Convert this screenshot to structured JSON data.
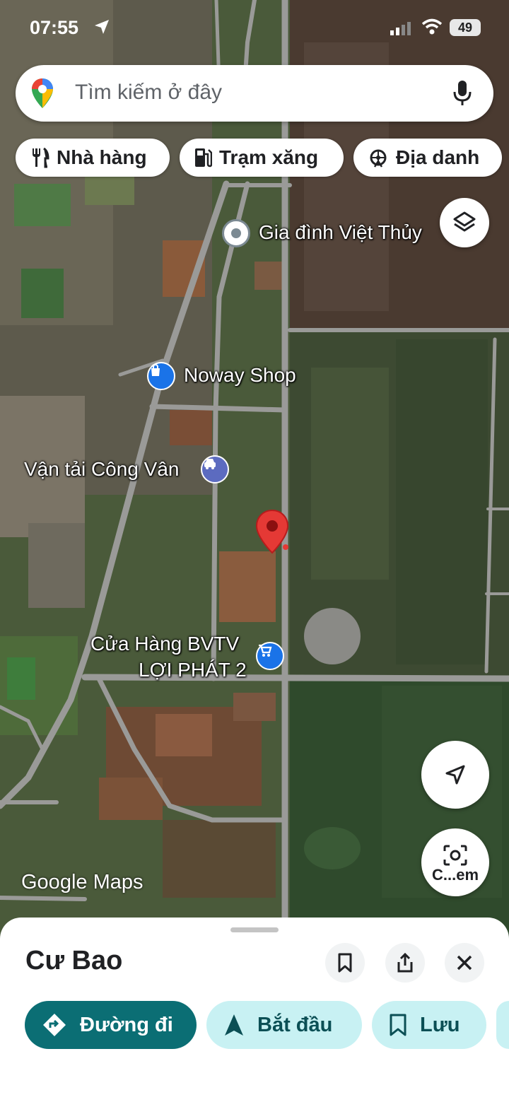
{
  "status_bar": {
    "time": "07:55",
    "battery": "49"
  },
  "search": {
    "placeholder": "Tìm kiếm ở đây"
  },
  "chips": [
    {
      "label": "Nhà hàng",
      "icon": "restaurant-icon"
    },
    {
      "label": "Trạm xăng",
      "icon": "gas-station-icon"
    },
    {
      "label": "Địa danh",
      "icon": "landmark-icon"
    }
  ],
  "map": {
    "places": [
      {
        "name": "Gia đình Việt Thủy",
        "icon": "place-dot-icon"
      },
      {
        "name": "Noway Shop",
        "icon": "shopping-bag-icon"
      },
      {
        "name": "Vận tải Công Vân",
        "icon": "car-icon"
      },
      {
        "name": "Cửa Hàng BVTV",
        "name2": "LỢI PHÁT 2",
        "icon": "shopping-cart-icon"
      }
    ],
    "watermark": "Google Maps"
  },
  "controls": {
    "camera_label": "C...em"
  },
  "sheet": {
    "title": "Cư Bao",
    "actions": {
      "directions": "Đường đi",
      "start": "Bắt đầu",
      "save": "Lưu"
    }
  },
  "colors": {
    "accent": "#0b6e74",
    "pill_light": "#c8f1f3",
    "pin": "#e53935",
    "poi": "#1a73e8"
  }
}
